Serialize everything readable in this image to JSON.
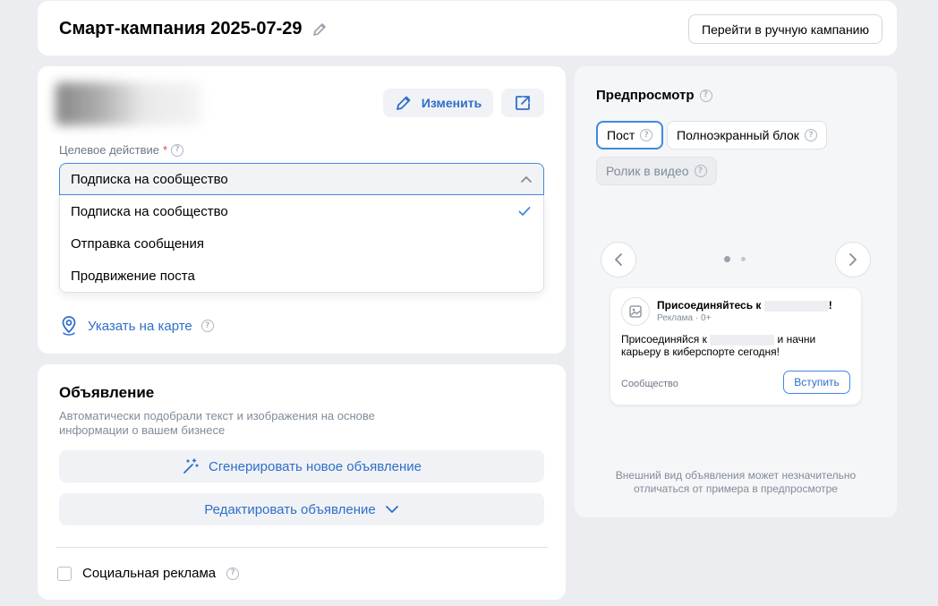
{
  "header": {
    "campaign_title": "Смарт-кампания 2025-07-29",
    "manual_button": "Перейти в ручную кампанию"
  },
  "target": {
    "edit_label": "Изменить",
    "field_label": "Целевое действие",
    "required_mark": "*",
    "selected": "Подписка на сообщество",
    "options": [
      "Подписка на сообщество",
      "Отправка сообщения",
      "Продвижение поста"
    ],
    "map_link": "Указать на карте"
  },
  "ad": {
    "title": "Объявление",
    "description": "Автоматически подобрали текст и изображения на основе информации о вашем бизнесе",
    "generate_button": "Сгенерировать новое объявление",
    "edit_button": "Редактировать объявление",
    "social_label": "Социальная реклама"
  },
  "preview": {
    "title": "Предпросмотр",
    "tabs": [
      "Пост",
      "Полноэкранный блок",
      "Ролик в видео"
    ],
    "post": {
      "headline_prefix": "Присоединяйтесь к",
      "headline_suffix": "!",
      "subline": "Реклама · 0+",
      "body_prefix": "Присоединяйся к",
      "body_suffix": "и начни карьеру в киберспорте сегодня!",
      "footer": "Сообщество",
      "cta": "Вступить"
    },
    "note": "Внешний вид объявления может незначительно отличаться от примера в предпросмотре"
  },
  "colors": {
    "accent": "#2f6fc9",
    "focus_border": "#3f8ae0",
    "page_bg": "#ebedf0",
    "required": "#e64646"
  }
}
